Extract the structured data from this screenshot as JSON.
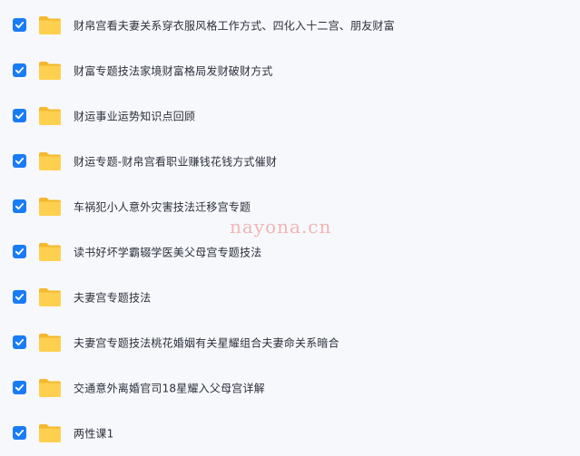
{
  "colors": {
    "checkbox": "#1a7cf5",
    "folder_back": "#f5b82e",
    "folder_front": "#ffd04f",
    "text": "#2b2f3a",
    "watermark": "#f0a9a9",
    "background": "#f7f8fc"
  },
  "icons": {
    "checkbox": "checkmark-icon",
    "folder": "folder-icon"
  },
  "files": [
    {
      "name": "财帛宫看夫妻关系穿衣服风格工作方式、四化入十二宫、朋友财富",
      "checked": true
    },
    {
      "name": "财富专题技法家境财富格局发财破财方式",
      "checked": true
    },
    {
      "name": "财运事业运势知识点回顾",
      "checked": true
    },
    {
      "name": "财运专题-财帛宫看职业赚钱花钱方式催财",
      "checked": true
    },
    {
      "name": "车祸犯小人意外灾害技法迁移宫专题",
      "checked": true
    },
    {
      "name": "读书好坏学霸辍学医美父母宫专题技法",
      "checked": true
    },
    {
      "name": "夫妻宫专题技法",
      "checked": true
    },
    {
      "name": "夫妻宫专题技法桃花婚姻有关星耀组合夫妻命关系暗合",
      "checked": true
    },
    {
      "name": "交通意外离婚官司18星耀入父母宫详解",
      "checked": true
    },
    {
      "name": "两性课1",
      "checked": true
    }
  ],
  "watermark": "nayona.cn"
}
